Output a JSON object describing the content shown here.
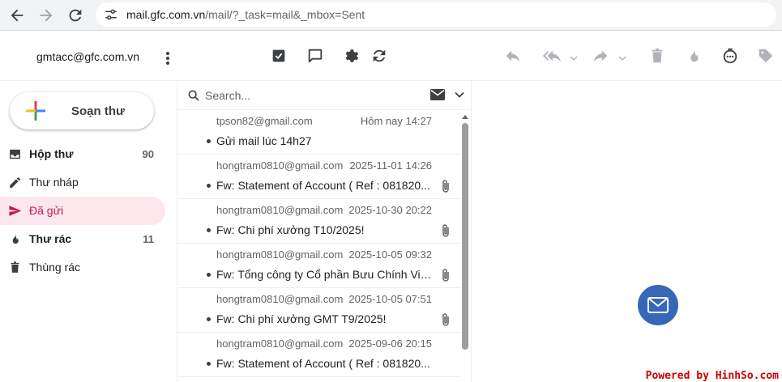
{
  "browser": {
    "url_host": "mail.gfc.com.vn",
    "url_path": "/mail/?_task=mail&_mbox=Sent"
  },
  "header": {
    "account": "gmtacc@gfc.com.vn",
    "toolbar_icons": [
      "select-icon",
      "chat-icon",
      "gear-icon",
      "refresh-icon",
      "reply-icon",
      "reply-all-icon",
      "forward-icon",
      "trash-icon",
      "spam-icon",
      "more-icon",
      "tag-icon"
    ]
  },
  "sidebar": {
    "compose_label": "Soạn thư",
    "folders": [
      {
        "label": "Hộp thư",
        "count": "90",
        "icon": "inbox-icon"
      },
      {
        "label": "Thư nháp",
        "count": "",
        "icon": "pencil-icon"
      },
      {
        "label": "Đã gửi",
        "count": "",
        "icon": "send-icon"
      },
      {
        "label": "Thư rác",
        "count": "11",
        "icon": "flame-icon"
      },
      {
        "label": "Thùng rác",
        "count": "",
        "icon": "trash-icon"
      }
    ]
  },
  "search": {
    "placeholder": "Search..."
  },
  "messages": [
    {
      "from": "tpson82@gmail.com",
      "date": "Hôm nay 14:27",
      "subject": "Gửi mail lúc 14h27",
      "attachment": false
    },
    {
      "from": "hongtram0810@gmail.com",
      "date": "2025-11-01 14:26",
      "subject": "Fw: Statement of Account ( Ref : 081820...",
      "attachment": true
    },
    {
      "from": "hongtram0810@gmail.com",
      "date": "2025-10-30 20:22",
      "subject": "Fw: Chi phí xưởng T10/2025!",
      "attachment": true
    },
    {
      "from": "hongtram0810@gmail.com",
      "date": "2025-10-05 09:32",
      "subject": "Fw: Tổng công ty Cổ phần Bưu Chính Viet...",
      "attachment": true
    },
    {
      "from": "hongtram0810@gmail.com",
      "date": "2025-10-05 07:51",
      "subject": "Fw: Chi phí xưởng GMT T9/2025!",
      "attachment": true
    },
    {
      "from": "hongtram0810@gmail.com",
      "date": "2025-09-06 20:15",
      "subject": "Fw: Statement of Account ( Ref : 081820...",
      "attachment": false
    }
  ],
  "watermark": "Powered by HinhSo.com",
  "colors": {
    "accent": "#c2185b",
    "active_bg": "#fce8ec",
    "envelope_circle": "#3667b8"
  }
}
